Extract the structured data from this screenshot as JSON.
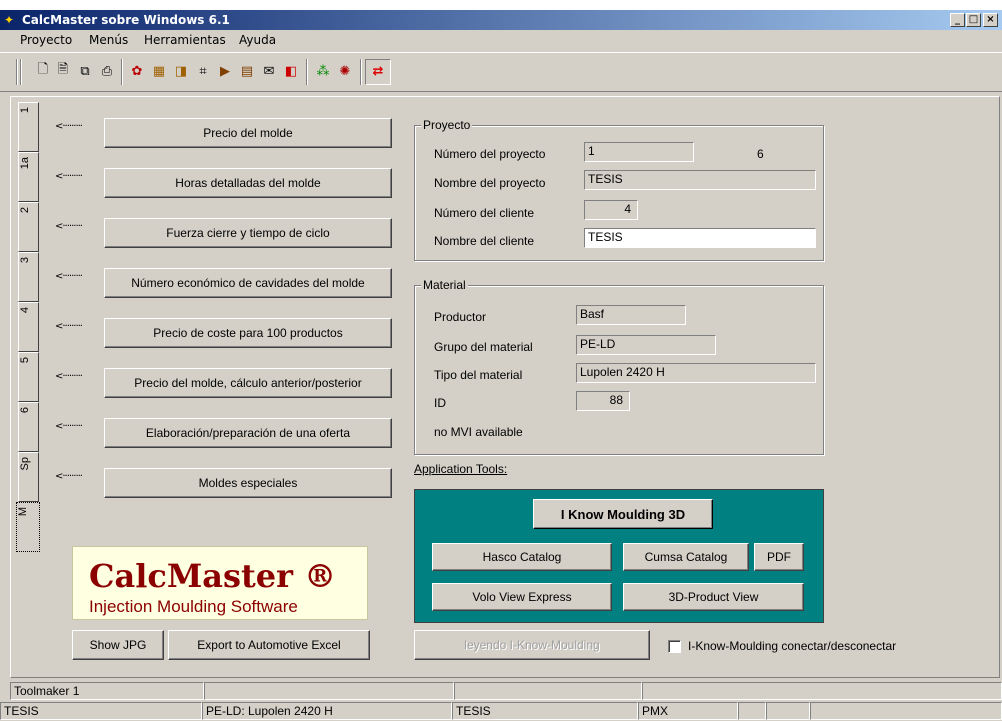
{
  "window": {
    "title": "CalcMaster sobre Windows 6.1",
    "minimize": "_",
    "maximize": "□",
    "close": "×"
  },
  "menu": [
    "Proyecto",
    "Menús",
    "Herramientas",
    "Ayuda"
  ],
  "toolbar_icons": [
    "new-doc-icon",
    "open-doc-icon",
    "copy-doc-icon",
    "print-icon",
    "module-icon",
    "grid-icon",
    "frame-icon",
    "tree-icon",
    "machine-icon",
    "list-icon",
    "mail-icon",
    "flag-icon",
    "chart-icon",
    "globe-icon",
    "refresh-icon"
  ],
  "tabs": [
    "1",
    "1a",
    "2",
    "3",
    "4",
    "5",
    "6",
    "Sp",
    "M"
  ],
  "active_tab": "M",
  "arrow_text": "<·········",
  "actions": [
    "Precio del molde",
    "Horas detalladas del molde",
    "Fuerza cierre y tiempo de ciclo",
    "Número económico de cavidades del molde",
    "Precio de coste para 100 productos",
    "Precio del molde, cálculo anterior/posterior",
    "Elaboración/preparación de una oferta",
    "Moldes especiales"
  ],
  "proyecto": {
    "legend": "Proyecto",
    "numero_label": "Número del proyecto",
    "numero_value": "1",
    "numero_extra": "6",
    "nombre_label": "Nombre del proyecto",
    "nombre_value": "TESIS",
    "cliente_num_label": "Número del cliente",
    "cliente_num_value": "4",
    "cliente_nombre_label": "Nombre del cliente",
    "cliente_nombre_value": "TESIS"
  },
  "material": {
    "legend": "Material",
    "productor_label": "Productor",
    "productor_value": "Basf",
    "grupo_label": "Grupo del material",
    "grupo_value": "PE-LD",
    "tipo_label": "Tipo del material",
    "tipo_value": "Lupolen 2420 H",
    "id_label": "ID",
    "id_value": "88",
    "mvi_text": "no MVI available"
  },
  "app_tools": {
    "label": "Application Tools:",
    "iknow": "I Know Moulding 3D",
    "hasco": "Hasco Catalog",
    "cumsa": "Cumsa Catalog",
    "pdf": "PDF",
    "volo": "Volo View Express",
    "product3d": "3D-Product View"
  },
  "logo": {
    "title": "CalcMaster ®",
    "subtitle": "Injection Moulding Software"
  },
  "bottom": {
    "show_jpg": "Show JPG",
    "export_excel": "Export to Automotive Excel",
    "leyendo": "leyendo I-Know-Moulding",
    "toggle_label": "I-Know-Moulding conectar/desconectar"
  },
  "status": {
    "row1": [
      "Toolmaker 1",
      "",
      "",
      "",
      ""
    ],
    "row2": [
      "TESIS",
      "PE-LD: Lupolen 2420 H",
      "TESIS",
      "PMX",
      "",
      "",
      ""
    ]
  },
  "colors": {
    "titlebar_start": "#0a246a",
    "tools_bg": "#008080",
    "logo_text": "#8b0000",
    "logo_bg": "#ffffe1"
  }
}
